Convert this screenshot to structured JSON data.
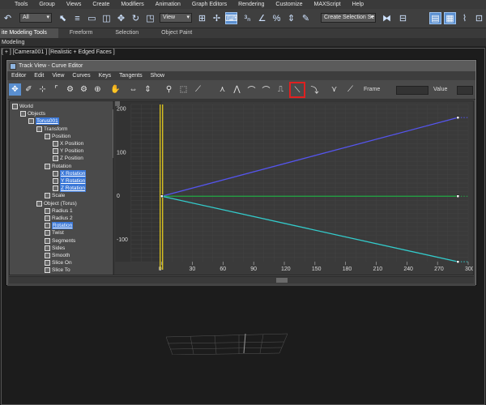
{
  "menubar": [
    "Tools",
    "Group",
    "Views",
    "Create",
    "Modifiers",
    "Animation",
    "Graph Editors",
    "Rendering",
    "Customize",
    "MAXScript",
    "Help"
  ],
  "toolbar": {
    "filter_value": "All",
    "ref_coord_value": "View",
    "selection_set_placeholder": "Create Selection Se"
  },
  "ribbon": {
    "tabs": [
      "ite Modeling Tools",
      "Freeform",
      "Selection",
      "Object Paint"
    ]
  },
  "subbar_label": "Modeling",
  "viewport_label": "[ + ] [Camera001 ] [Realistic + Edged Faces ]",
  "trackview": {
    "title": "Track View - Curve Editor",
    "menu": [
      "Editor",
      "Edit",
      "View",
      "Curves",
      "Keys",
      "Tangents",
      "Show"
    ],
    "frame_label": "Frame",
    "value_label": "Value",
    "tree": [
      {
        "label": "World",
        "indent": 0,
        "sel": false
      },
      {
        "label": "Objects",
        "indent": 1,
        "sel": false
      },
      {
        "label": "Torus001",
        "indent": 2,
        "sel": true
      },
      {
        "label": "Transform",
        "indent": 3,
        "sel": false
      },
      {
        "label": "Position",
        "indent": 4,
        "sel": false
      },
      {
        "label": "X Position",
        "indent": 5,
        "sel": false
      },
      {
        "label": "Y Position",
        "indent": 5,
        "sel": false
      },
      {
        "label": "Z Position",
        "indent": 5,
        "sel": false
      },
      {
        "label": "Rotation",
        "indent": 4,
        "sel": false
      },
      {
        "label": "X Rotation",
        "indent": 5,
        "sel": true
      },
      {
        "label": "Y Rotation",
        "indent": 5,
        "sel": true
      },
      {
        "label": "Z Rotation",
        "indent": 5,
        "sel": true
      },
      {
        "label": "Scale",
        "indent": 4,
        "sel": false
      },
      {
        "label": "Object (Torus)",
        "indent": 3,
        "sel": false
      },
      {
        "label": "Radius 1",
        "indent": 4,
        "sel": false
      },
      {
        "label": "Radius 2",
        "indent": 4,
        "sel": false
      },
      {
        "label": "Rotation",
        "indent": 4,
        "sel": true
      },
      {
        "label": "Twist",
        "indent": 4,
        "sel": false
      },
      {
        "label": "Segments",
        "indent": 4,
        "sel": false
      },
      {
        "label": "Sides",
        "indent": 4,
        "sel": false
      },
      {
        "label": "Smooth",
        "indent": 4,
        "sel": false
      },
      {
        "label": "Slice On",
        "indent": 4,
        "sel": false
      },
      {
        "label": "Slice To",
        "indent": 4,
        "sel": false
      }
    ]
  },
  "chart_data": {
    "type": "line",
    "x_ticks": [
      0,
      30,
      60,
      90,
      120,
      150,
      180,
      210,
      240,
      270,
      300
    ],
    "y_ticks": [
      200,
      100,
      0,
      -100
    ],
    "xlim": [
      -30,
      300
    ],
    "ylim": [
      -150,
      210
    ],
    "series": [
      {
        "color": "#5555ee",
        "x": [
          0,
          290
        ],
        "y": [
          0,
          180
        ]
      },
      {
        "color": "#22aa44",
        "x": [
          0,
          290
        ],
        "y": [
          0,
          0
        ]
      },
      {
        "color": "#33cccc",
        "x": [
          0,
          290
        ],
        "y": [
          0,
          -150
        ]
      }
    ],
    "time_slider_frame": 0
  }
}
